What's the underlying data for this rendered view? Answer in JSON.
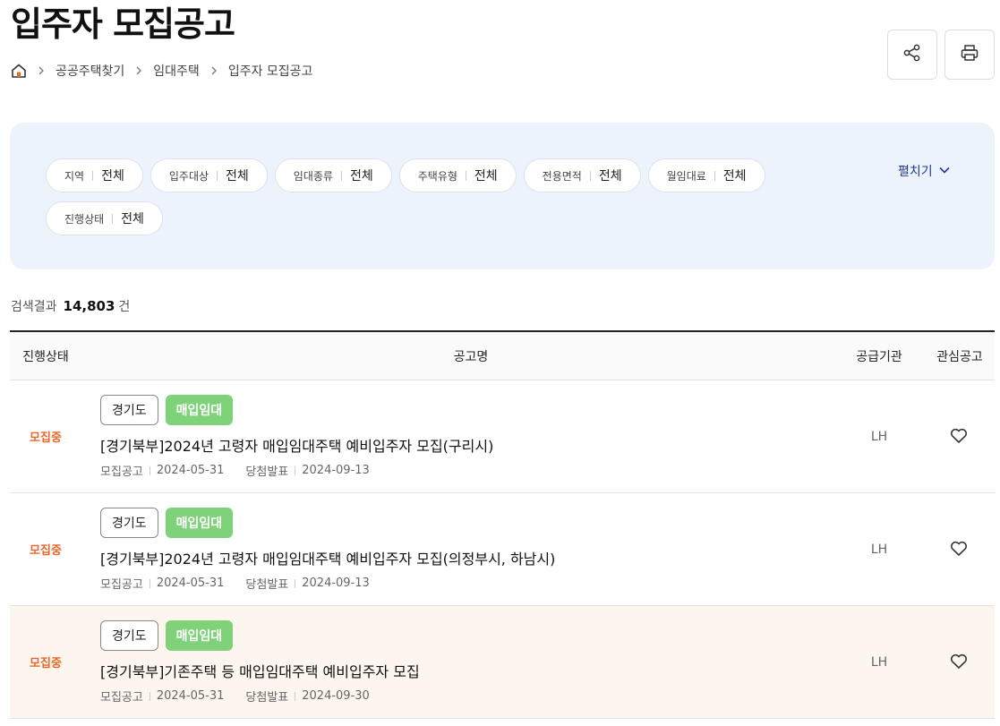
{
  "page_title": "입주자 모집공고",
  "breadcrumb": {
    "home_icon": "home-icon",
    "items": [
      "공공주택찾기",
      "임대주택",
      "입주자 모집공고"
    ]
  },
  "actions": {
    "share_icon": "share-icon",
    "print_icon": "print-icon"
  },
  "filters": {
    "chips": [
      {
        "label": "지역",
        "value": "전체"
      },
      {
        "label": "입주대상",
        "value": "전체"
      },
      {
        "label": "임대종류",
        "value": "전체"
      },
      {
        "label": "주택유형",
        "value": "전체"
      },
      {
        "label": "전용면적",
        "value": "전체"
      },
      {
        "label": "월임대료",
        "value": "전체"
      },
      {
        "label": "진행상태",
        "value": "전체"
      }
    ],
    "expand_label": "펼치기"
  },
  "results": {
    "label": "검색결과",
    "count": "14,803",
    "unit": "건"
  },
  "table": {
    "headers": {
      "status": "진행상태",
      "name": "공고명",
      "org": "공급기관",
      "fav": "관심공고"
    },
    "rows": [
      {
        "status": "모집중",
        "region": "경기도",
        "type": "매입임대",
        "title": "[경기북부]2024년 고령자 매입임대주택 예비입주자 모집(구리시)",
        "notice_label": "모집공고",
        "notice_date": "2024-05-31",
        "result_label": "당첨발표",
        "result_date": "2024-09-13",
        "org": "LH"
      },
      {
        "status": "모집중",
        "region": "경기도",
        "type": "매입임대",
        "title": "[경기북부]2024년 고령자 매입임대주택 예비입주자 모집(의정부시, 하남시)",
        "notice_label": "모집공고",
        "notice_date": "2024-05-31",
        "result_label": "당첨발표",
        "result_date": "2024-09-13",
        "org": "LH"
      },
      {
        "status": "모집중",
        "region": "경기도",
        "type": "매입임대",
        "title": "[경기북부]기존주택 등 매입임대주택 예비입주자 모집",
        "notice_label": "모집공고",
        "notice_date": "2024-05-31",
        "result_label": "당첨발표",
        "result_date": "2024-09-30",
        "org": "LH"
      }
    ]
  },
  "colors": {
    "accent_status": "#e8682a",
    "type_tag": "#7fd27a",
    "filter_bg": "#edf3fd",
    "expand": "#1f3c88",
    "highlight_row": "#fdf6ee"
  }
}
